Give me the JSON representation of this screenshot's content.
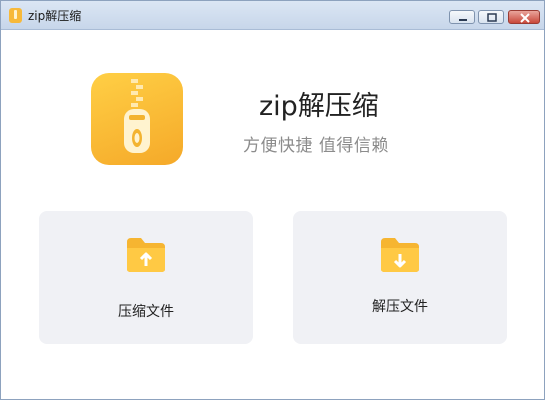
{
  "window": {
    "title": "zip解压缩",
    "controls": [
      "minimize",
      "maximize",
      "close"
    ]
  },
  "hero": {
    "logo_icon": "zip-file-icon",
    "app_name": "zip解压缩",
    "slogan": "方便快捷  值得信赖"
  },
  "actions": [
    {
      "label": "压缩文件",
      "icon": "folder-upload-icon"
    },
    {
      "label": "解压文件",
      "icon": "folder-download-icon"
    }
  ],
  "colors": {
    "accent": "#f7b93a",
    "card_bg": "#f0f1f5",
    "slogan_text": "#8c8c8c"
  }
}
